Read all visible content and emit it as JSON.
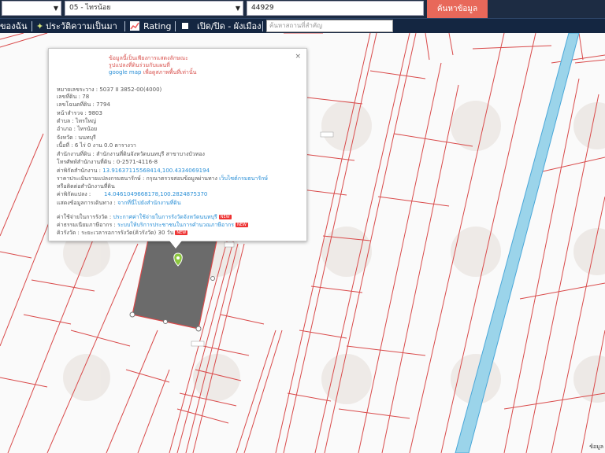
{
  "search": {
    "province_value": "05 - ไทรน้อย",
    "parcel_input": "44929",
    "search_button": "ค้นหาข้อมูล"
  },
  "nav": {
    "mine": "ของฉัน",
    "history": "ประวัติความเป็นมา",
    "rating": "Rating",
    "toggle": "เปิด/ปิด - ผังเมือง",
    "place_placeholder": "ค้นหาสถานที่สำคัญ"
  },
  "popup": {
    "notice_1": "ข้อมูลนี้เป็นเพียงการแสดงลักษณะ",
    "notice_2": "รูปแปลงที่ดินร่วมกับแผนที่",
    "notice_3a": "google map",
    "notice_3b": " เพื่อดูสภาพพื้นที่เท่านั้น",
    "close": "×",
    "rows": [
      {
        "label": "หมายเลขระวาง : ",
        "value": "5037 II 3852-00(4000)"
      },
      {
        "label": "เลขที่ดิน : ",
        "value": "78"
      },
      {
        "label": "เลขโฉนดที่ดิน : ",
        "value": "7794"
      },
      {
        "label": "หน้าสำรวจ : ",
        "value": "9803"
      },
      {
        "label": "ตำบล : ",
        "value": "ไทรใหญ่"
      },
      {
        "label": "อำเภอ : ",
        "value": "ไทรน้อย"
      },
      {
        "label": "จังหวัด : ",
        "value": "นนทบุรี"
      },
      {
        "label": "เนื้อที่ : ",
        "value": "6 ไร่ 0 งาน 0.0 ตารางวา"
      },
      {
        "label": "สำนักงานที่ดิน : ",
        "value": "สำนักงานที่ดินจังหวัดนนทบุรี สาขาบางบัวทอง"
      },
      {
        "label": "โทรศัพท์สำนักงานที่ดิน : ",
        "value": "0-2571-4116-8"
      }
    ],
    "office_coord_label": "ค่าพิกัดสำนักงาน : ",
    "office_coord_value": "13.91637115568414,100.4334069194",
    "price_label": "ราคาประเมินรายแปลงกรมธนารักษ์ : ",
    "price_text": "กรุณาตรวจสอบข้อมูลผ่านทาง ",
    "price_link": "เว็บไซต์กรมธนารักษ์",
    "price_text_2": "หรือติดต่อสำนักงานที่ดิน",
    "parcel_coord_label": "ค่าพิกัดแปลง : ",
    "parcel_coord_value": "14.0461049668178,100.2824875370",
    "route_label": "แสดงข้อมูลการเดินทาง : ",
    "route_link": "จากที่นี่ไปยังสำนักงานที่ดิน",
    "fee_label": "ค่าใช้จ่ายในการรังวัด : ",
    "fee_link": "ประกาศค่าใช้จ่ายในการรังวัดจังหวัดนนทบุรี",
    "tax_label": "ค่าธรรมเนียมภาษีอากร : ",
    "tax_link": "ระบบให้บริการประชาชนในการคำนวณภาษีอากร",
    "survey_label": "คิวรังวัด : ",
    "survey_value": "ระยะเวลารอการรังวัด(คิวรังวัด) 30 วัน",
    "new_badge": "NEW"
  },
  "map": {
    "scale_label": "ข้อมูล"
  }
}
